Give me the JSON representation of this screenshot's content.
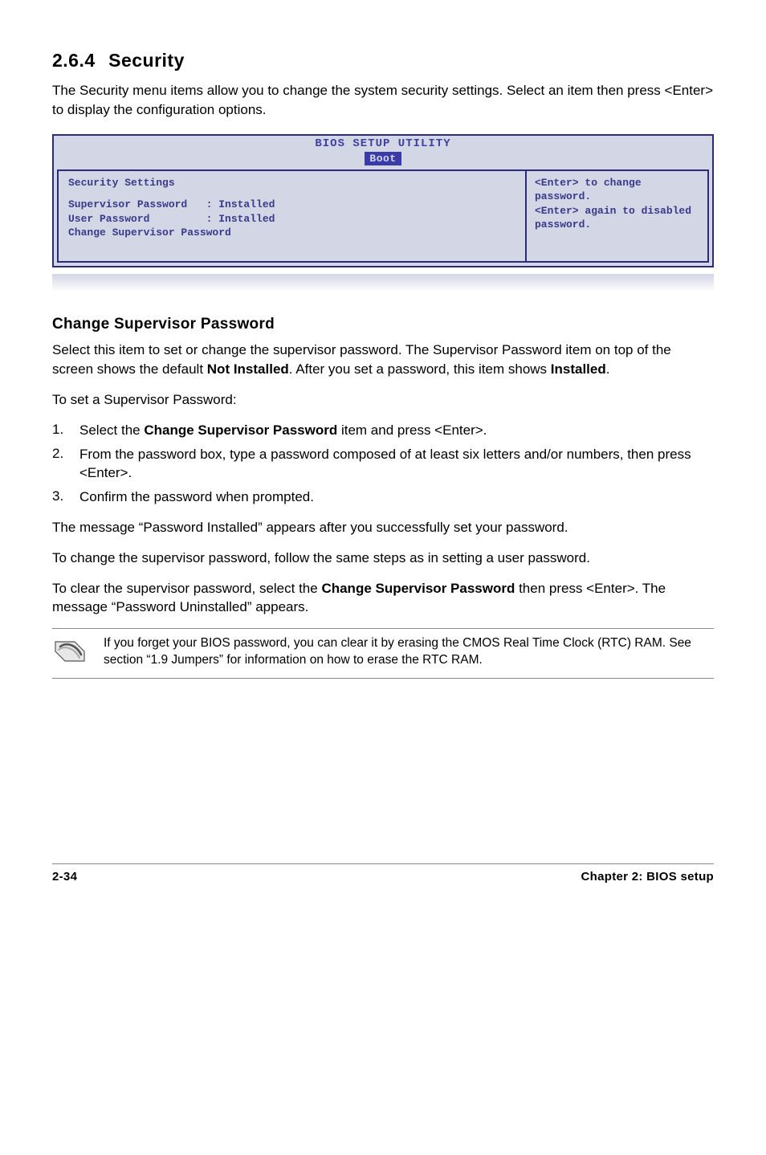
{
  "section": {
    "number": "2.6.4",
    "title": "Security"
  },
  "intro": "The Security menu items allow you to change the system security settings. Select an item then press <Enter> to display the configuration options.",
  "bios": {
    "title": "BIOS SETUP UTILITY",
    "tab": "Boot",
    "left": {
      "header": "Security Settings",
      "rows": [
        "Supervisor Password   : Installed",
        "User Password         : Installed"
      ],
      "change": "Change Supervisor Password"
    },
    "right": "<Enter> to change password.\n<Enter> again to disabled password."
  },
  "sub_heading": "Change Supervisor Password",
  "para1_pre": "Select this item to set or change the supervisor password. The Supervisor Password item on top of the screen shows the default ",
  "para1_bold1": "Not Installed",
  "para1_mid": ". After you set a password, this item shows ",
  "para1_bold2": "Installed",
  "para1_post": ".",
  "para2": "To set a Supervisor Password:",
  "steps": [
    {
      "n": "1.",
      "pre": "Select the ",
      "bold": "Change Supervisor Password",
      "post": " item and press <Enter>."
    },
    {
      "n": "2.",
      "pre": "From the password box, type a password composed of at least six letters and/or numbers, then press <Enter>.",
      "bold": "",
      "post": ""
    },
    {
      "n": "3.",
      "pre": "Confirm the password when prompted.",
      "bold": "",
      "post": ""
    }
  ],
  "para3": "The message “Password Installed” appears after you successfully set your password.",
  "para4": "To change the supervisor password, follow the same steps as in setting a user password.",
  "para5_pre": "To clear the supervisor password, select the ",
  "para5_bold": "Change Supervisor Password",
  "para5_post": " then press <Enter>. The message “Password Uninstalled” appears.",
  "note": "If you forget your BIOS password, you can clear it by erasing the CMOS Real Time Clock (RTC) RAM. See section “1.9  Jumpers” for information on how to erase the RTC RAM.",
  "footer": {
    "left": "2-34",
    "right": "Chapter 2: BIOS setup"
  }
}
